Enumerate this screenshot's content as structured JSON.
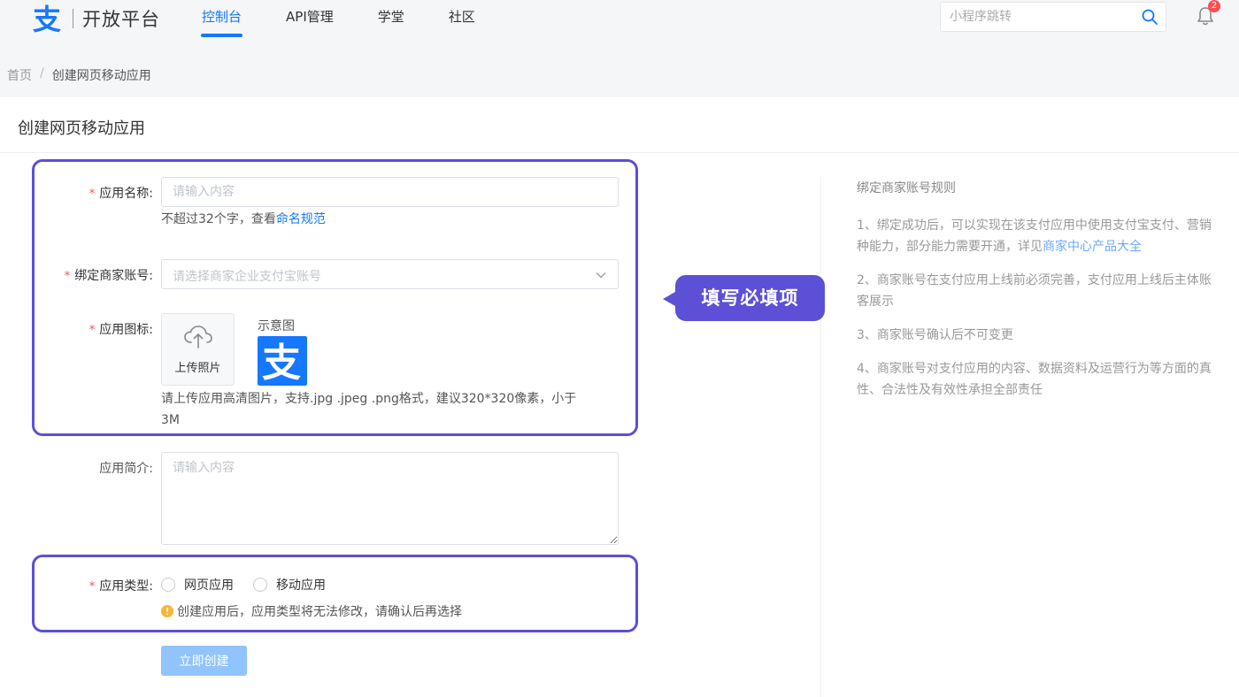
{
  "header": {
    "logo_text": "开放平台",
    "nav": [
      {
        "label": "控制台",
        "active": true
      },
      {
        "label": "API管理",
        "active": false
      },
      {
        "label": "学堂",
        "active": false
      },
      {
        "label": "社区",
        "active": false
      }
    ],
    "search_placeholder": "小程序跳转",
    "notification_count": "2"
  },
  "breadcrumb": {
    "home": "首页",
    "separator": "/",
    "current": "创建网页移动应用"
  },
  "page_title": "创建网页移动应用",
  "form": {
    "name": {
      "label": "应用名称:",
      "placeholder": "请输入内容",
      "hint_prefix": "不超过32个字，查看",
      "hint_link": "命名规范"
    },
    "merchant": {
      "label": "绑定商家账号:",
      "placeholder": "请选择商家企业支付宝账号"
    },
    "icon": {
      "label": "应用图标:",
      "upload_label": "上传照片",
      "sample_label": "示意图",
      "hint_line1": "请上传应用高清图片，支持.jpg .jpeg .png格式，建议320*320像素，小于",
      "hint_line2": "3M"
    },
    "intro": {
      "label": "应用简介:",
      "placeholder": "请输入内容"
    },
    "type": {
      "label": "应用类型:",
      "options": [
        "网页应用",
        "移动应用"
      ],
      "warning": "创建应用后，应用类型将无法修改，请确认后再选择"
    },
    "submit_label": "立即创建"
  },
  "callout": "填写必填项",
  "rules": {
    "title": "绑定商家账号规则",
    "items": [
      {
        "line1": "1、绑定成功后，可以实现在该支付应用中使用支付宝支付、营销",
        "line2_prefix": "种能力，部分能力需要开通，详见",
        "line2_link": "商家中心产品大全"
      },
      {
        "line1": "2、商家账号在支付应用上线前必须完善，支付应用上线后主体账",
        "line2": "客展示"
      },
      {
        "line1": "3、商家账号确认后不可变更"
      },
      {
        "line1": "4、商家账号对支付应用的内容、数据资料及运营行为等方面的真",
        "line2": "性、合法性及有效性承担全部责任"
      }
    ]
  },
  "colors": {
    "brand": "#1677ff",
    "highlight": "#5b50d6",
    "required": "#ff4d4f",
    "submit_disabled": "#91c3fc"
  }
}
